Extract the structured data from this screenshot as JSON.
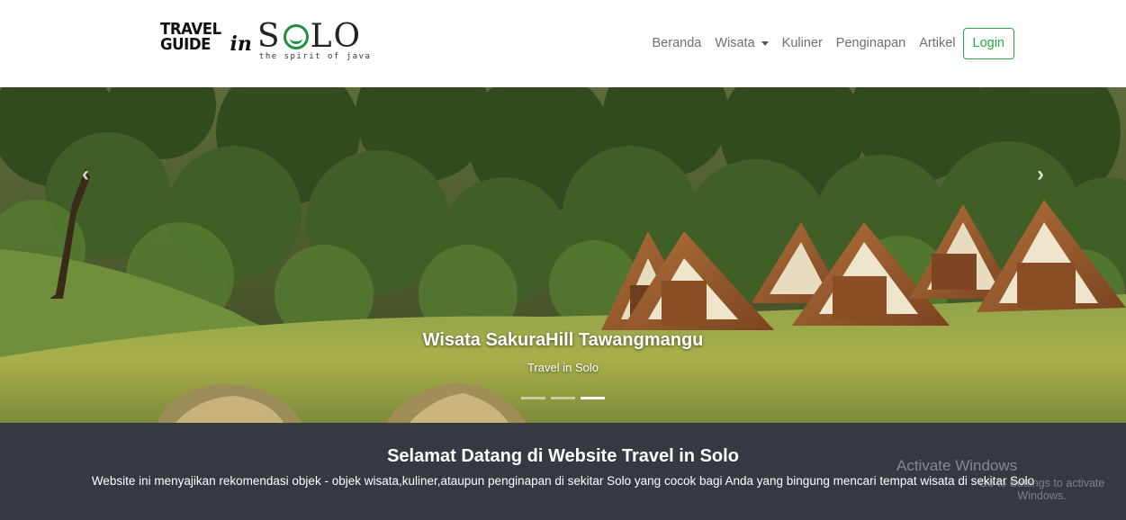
{
  "brand": {
    "line1": "TRAVEL",
    "line2": "GUIDE",
    "in": "in",
    "solo_s": "S",
    "solo_lo": "LO",
    "tagline": "the spirit of java"
  },
  "nav": {
    "items": [
      "Beranda",
      "Wisata",
      "Kuliner",
      "Penginapan",
      "Artikel"
    ],
    "login": "Login"
  },
  "carousel": {
    "title": "Wisata SakuraHill Tawangmangu",
    "subtitle": "Travel in Solo",
    "prev_icon": "chevron-left-icon",
    "next_icon": "chevron-right-icon",
    "prev_glyph": "‹",
    "next_glyph": "›",
    "active_index": 2,
    "slide_count": 3
  },
  "welcome": {
    "title": "Selamat Datang di Website Travel in Solo",
    "text": "Website ini menyajikan rekomendasi objek - objek wisata,kuliner,ataupun penginapan di sekitar Solo yang cocok bagi Anda yang bingung mencari tempat wisata di sekitar Solo"
  },
  "watermark": {
    "line1": "Activate Windows",
    "line2": "Go to Settings to activate Windows."
  },
  "colors": {
    "accent": "#28a745",
    "footer_bg": "#343a40",
    "nav_text": "#6f6f6f"
  }
}
